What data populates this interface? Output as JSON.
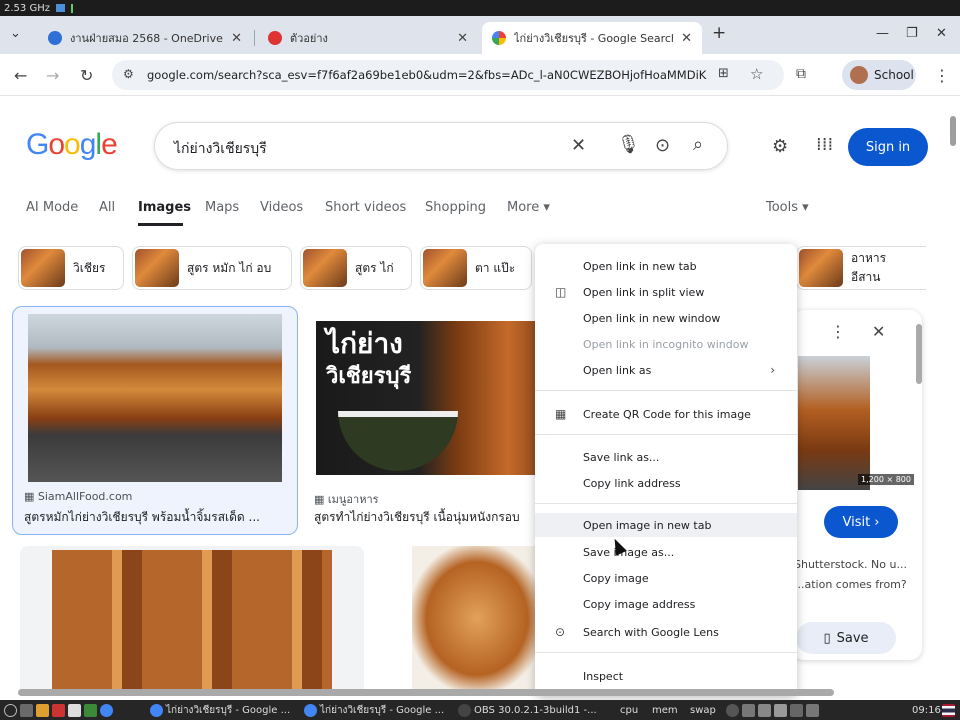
{
  "os_bar": {
    "cpu_freq": "2.53 GHz"
  },
  "browser": {
    "tabs": [
      {
        "title": "งานฝ่ายสมอ 2568 - OneDrive",
        "fav_color": "#2f6fd6"
      },
      {
        "title": "ตัวอย่าง",
        "fav_color": "#d33"
      },
      {
        "title": "ไก่ย่างวิเชียรบุรี - Google Search",
        "fav_color": "#4285f4"
      }
    ],
    "new_tab": "+",
    "url": "google.com/search?sca_esv=f7f6af2a69be1eb0&udm=2&fbs=ADc_l-aN0CWEZBOHjofHoaMMDiKpaEWj...",
    "profile_label": "School"
  },
  "google": {
    "logo": "Google",
    "query": "ไก่ย่างวิเชียรบุรี",
    "sign_in": "Sign in",
    "tabs": [
      "AI Mode",
      "All",
      "Images",
      "Maps",
      "Videos",
      "Short videos",
      "Shopping",
      "More"
    ],
    "selected_tab": "Images",
    "tools": "Tools",
    "chips": [
      "วิเชียร",
      "สูตร หมัก ไก่ อบ",
      "สูตร ไก่",
      "ตา แป๊ะ",
      "อาหาร อีสาน"
    ],
    "results": [
      {
        "source": "SiamAllFood.com",
        "title": "สูตรหมักไก่ย่างวิเชียรบุรี พร้อมน้ำจิ้มรสเด็ด ..."
      },
      {
        "source": "เมนูอาหาร",
        "title": "สูตรทำไก่ย่างวิเชียรบุรี เนื้อนุ่มหนังกรอบ"
      }
    ],
    "img2_text": [
      "ไก่ย่าง",
      "วิเชียรบุรี"
    ],
    "panel": {
      "dimensions": "1,200 × 800",
      "visit": "Visit ›",
      "text1": "Shutterstock. No u...",
      "text2": "...ation comes from?",
      "save": "Save"
    }
  },
  "context_menu": {
    "items": [
      {
        "label": "Open link in new tab"
      },
      {
        "label": "Open link in split view"
      },
      {
        "label": "Open link in new window"
      },
      {
        "label": "Open link in incognito window",
        "disabled": true
      },
      {
        "label": "Open link as"
      },
      {
        "label": "Create QR Code for this image"
      },
      {
        "label": "Save link as..."
      },
      {
        "label": "Copy link address"
      },
      {
        "label": "Open image in new tab"
      },
      {
        "label": "Save image as..."
      },
      {
        "label": "Copy image"
      },
      {
        "label": "Copy image address"
      },
      {
        "label": "Search with Google Lens"
      },
      {
        "label": "Inspect"
      }
    ]
  },
  "taskbar": {
    "items": [
      "ไก่ย่างวิเชียรบุรี - Google ...",
      "ไก่ย่างวิเชียรบุรี - Google ...",
      "OBS 30.0.2.1-3build1 -..."
    ],
    "monitors": [
      "cpu",
      "mem",
      "swap"
    ],
    "clock": "09:16"
  },
  "colors": {
    "accent": "#0b57d0",
    "google_blue": "#4285f4",
    "google_red": "#ea4335",
    "google_yellow": "#fbbc05",
    "google_green": "#34a853"
  }
}
